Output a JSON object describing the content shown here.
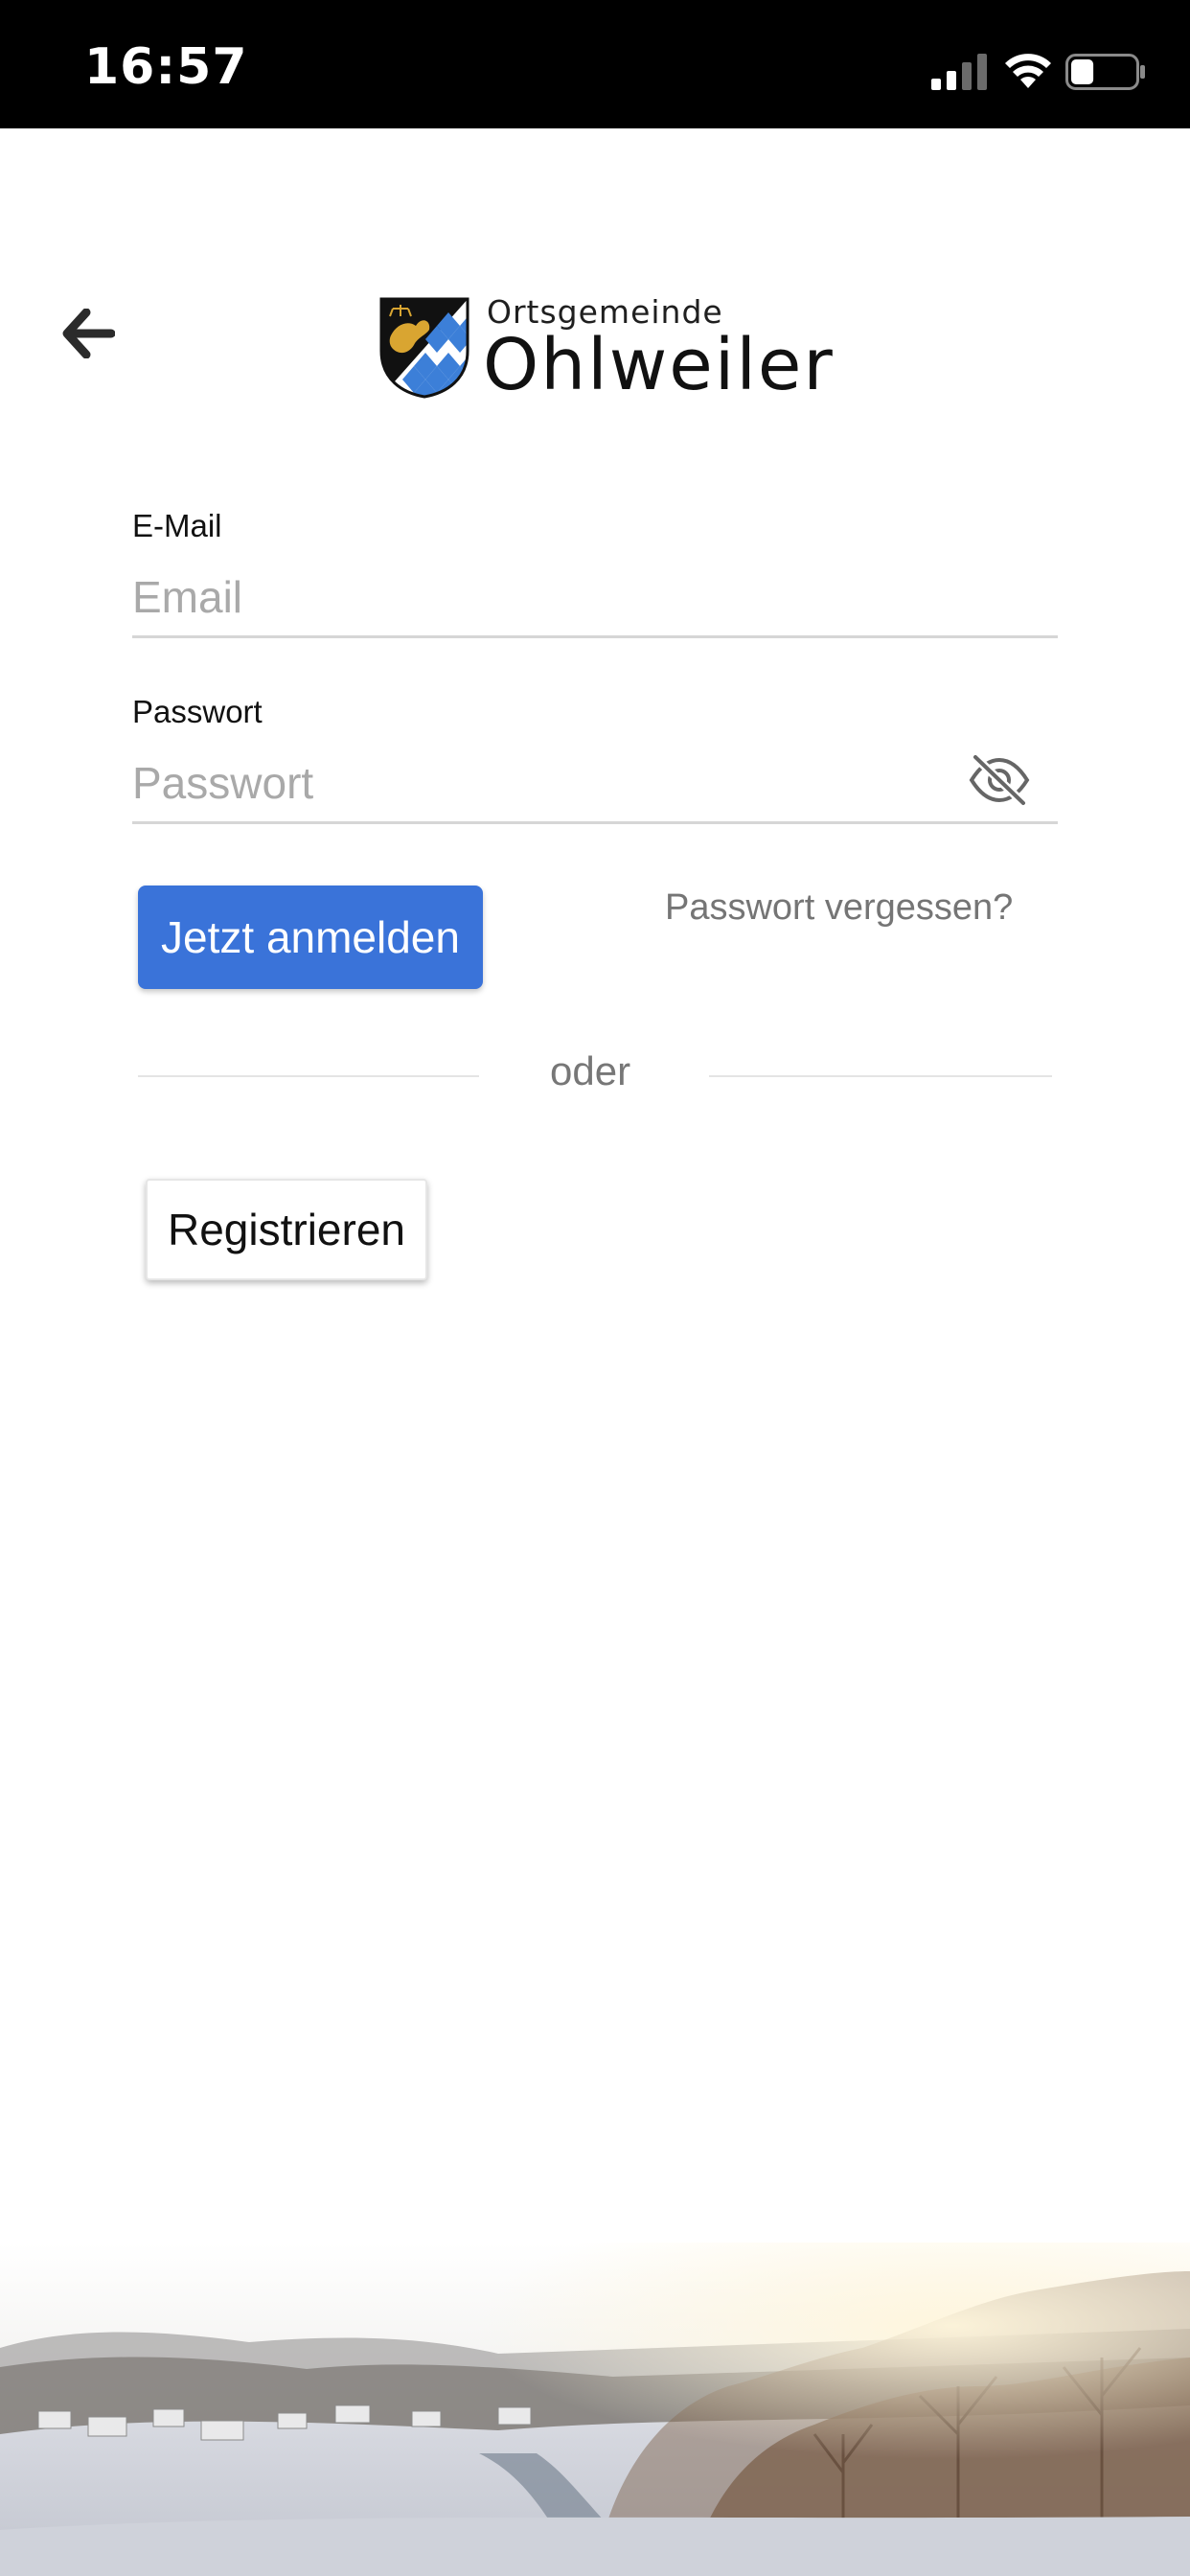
{
  "status_bar": {
    "time": "16:57",
    "icons": [
      "signal-icon",
      "wifi-icon",
      "battery-icon"
    ],
    "battery_level": 0.35
  },
  "header": {
    "back_icon": "arrow-left-icon",
    "logo_icon": "crest-icon",
    "logo_subtitle": "Ortsgemeinde",
    "logo_title": "Ohlweiler"
  },
  "form": {
    "email_label": "E-Mail",
    "email_placeholder": "Email",
    "email_value": "",
    "password_label": "Passwort",
    "password_placeholder": "Passwort",
    "password_value": "",
    "password_toggle_icon": "eye-off-icon",
    "login_button": "Jetzt anmelden",
    "forgot_link": "Passwort vergessen?",
    "divider_text": "oder",
    "register_button": "Registrieren"
  },
  "colors": {
    "primary": "#3a73d9",
    "status_bar": "#000000",
    "placeholder": "#a9a9a9",
    "link": "#757575"
  }
}
